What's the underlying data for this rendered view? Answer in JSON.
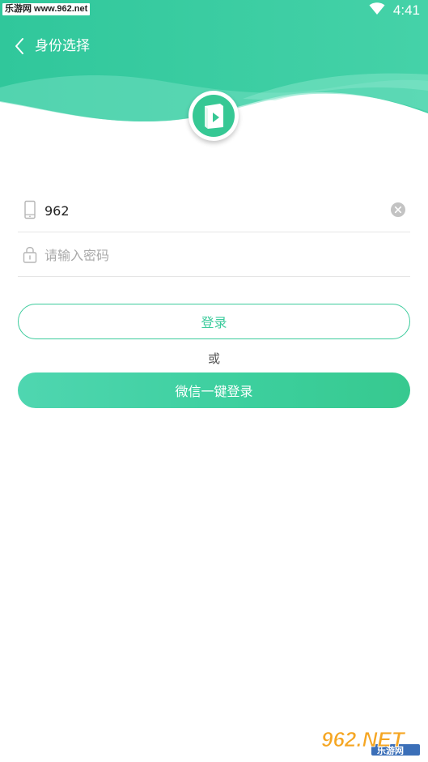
{
  "status_bar": {
    "watermark": "乐游网 www.962.net",
    "time": "4:41",
    "icons": [
      "wifi-icon"
    ]
  },
  "header": {
    "title": "身份选择",
    "back_icon": "chevron-left-icon",
    "logo_icon": "book-play-icon"
  },
  "form": {
    "phone": {
      "value": "962",
      "icon": "phone-icon",
      "clear_icon": "clear-circle-icon"
    },
    "password": {
      "placeholder": "请输入密码",
      "value": "",
      "icon": "lock-icon"
    }
  },
  "actions": {
    "login_label": "登录",
    "or_label": "或",
    "wechat_login_label": "微信一键登录"
  },
  "watermark_bottom": {
    "brand": "962.NET",
    "subtitle": "乐游网"
  },
  "colors": {
    "accent": "#3ccb9c",
    "header_gradient_start": "#2fc79a",
    "header_gradient_end": "#4fd7b2"
  }
}
